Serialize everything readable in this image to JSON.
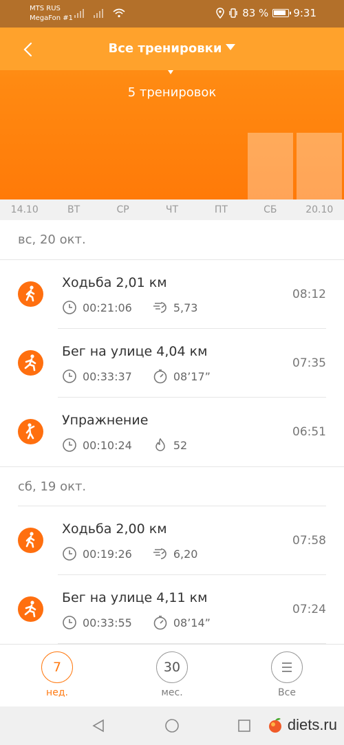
{
  "status": {
    "carrier1": "MTS RUS",
    "carrier2": "MegaFon #1",
    "battery": "83 %",
    "time": "9:31"
  },
  "header": {
    "title": "Все тренировки",
    "count_label": "5 тренировок"
  },
  "week_bars": [
    0,
    0,
    0,
    0,
    0,
    0.64,
    0.64
  ],
  "days": [
    "14.10",
    "ВТ",
    "СР",
    "ЧТ",
    "ПТ",
    "СБ",
    "20.10"
  ],
  "sections": [
    {
      "date": "вс, 20 окт.",
      "items": [
        {
          "name": "Ходьба 2,01 км",
          "duration": "00:21:06",
          "metric2": "5,73",
          "metric2_icon": "cadence-icon",
          "time": "08:12",
          "icon": "walking-icon"
        },
        {
          "name": "Бег на улице 4,04 км",
          "duration": "00:33:37",
          "metric2": "08’17”",
          "metric2_icon": "pace-icon",
          "time": "07:35",
          "icon": "running-icon"
        },
        {
          "name": "Упражнение",
          "duration": "00:10:24",
          "metric2": "52",
          "metric2_icon": "calories-icon",
          "time": "06:51",
          "icon": "exercise-icon"
        }
      ]
    },
    {
      "date": "сб, 19 окт.",
      "items": [
        {
          "name": "Ходьба 2,00 км",
          "duration": "00:19:26",
          "metric2": "6,20",
          "metric2_icon": "cadence-icon",
          "time": "07:58",
          "icon": "walking-icon"
        },
        {
          "name": "Бег на улице 4,11 км",
          "duration": "00:33:55",
          "metric2": "08’14”",
          "metric2_icon": "pace-icon",
          "time": "07:24",
          "icon": "running-icon"
        }
      ]
    }
  ],
  "tabs": [
    {
      "value": "7",
      "label": "нед."
    },
    {
      "value": "30",
      "label": "мес."
    },
    {
      "value": "",
      "label": "Все"
    }
  ],
  "watermark": "diets.ru",
  "colors": {
    "accent": "#ff7a12",
    "header_top": "#ffa22c",
    "statusbar": "#b3702a"
  }
}
